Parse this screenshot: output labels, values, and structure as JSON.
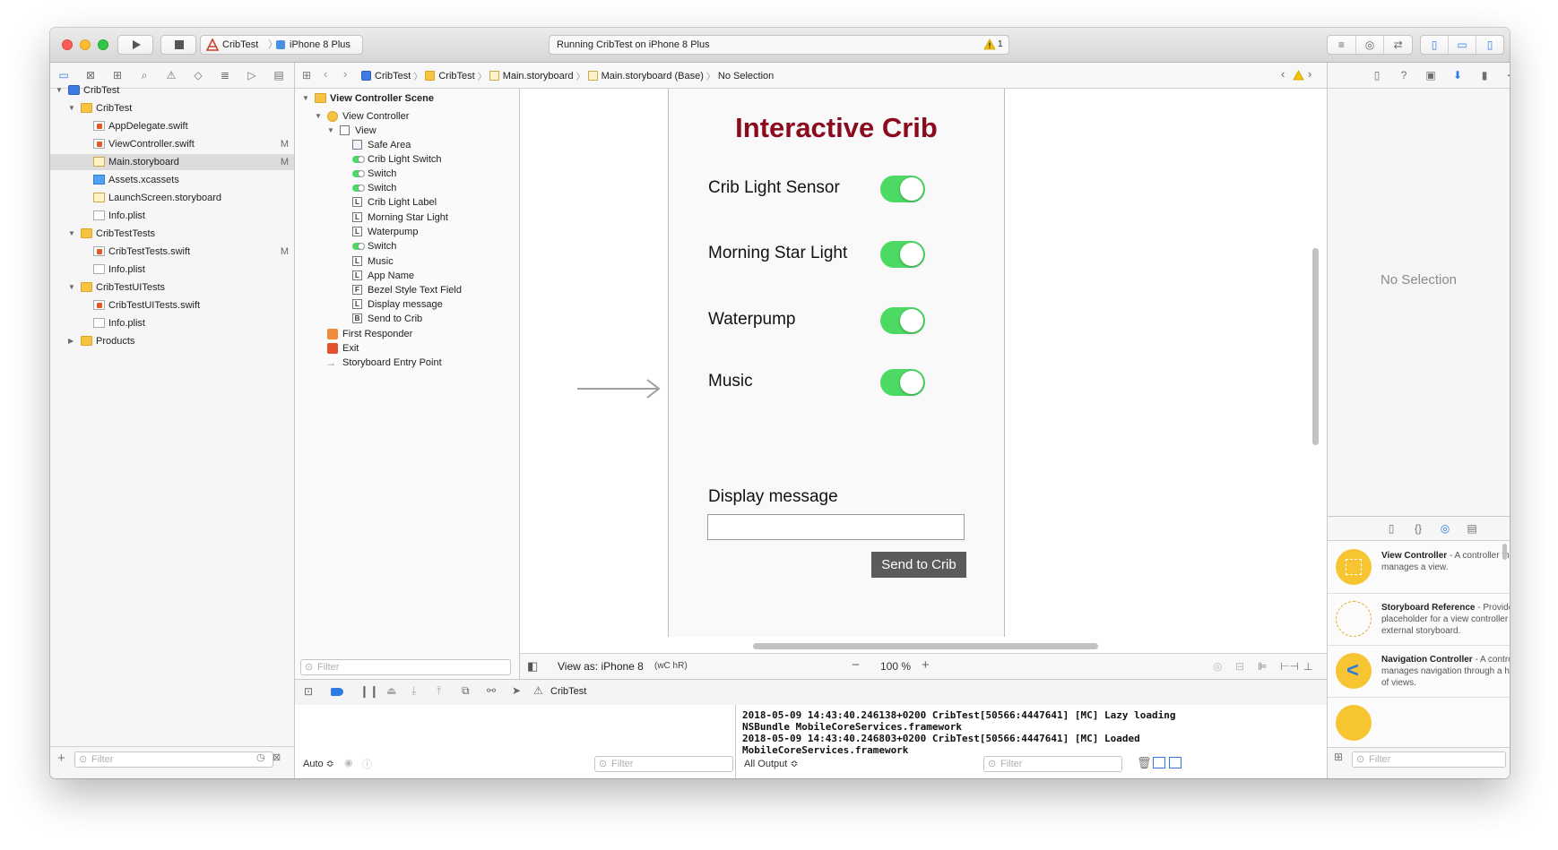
{
  "toolbar": {
    "scheme_project": "CribTest",
    "scheme_device": "iPhone 8 Plus",
    "status_text": "Running CribTest on iPhone 8 Plus",
    "warning_count": "1"
  },
  "jumpbar": {
    "items": [
      "CribTest",
      "CribTest",
      "Main.storyboard",
      "Main.storyboard (Base)",
      "No Selection"
    ]
  },
  "navigator": {
    "rows": [
      {
        "label": "CribTest",
        "mark": ""
      },
      {
        "label": "CribTest",
        "mark": ""
      },
      {
        "label": "AppDelegate.swift",
        "mark": ""
      },
      {
        "label": "ViewController.swift",
        "mark": "M"
      },
      {
        "label": "Main.storyboard",
        "mark": "M"
      },
      {
        "label": "Assets.xcassets",
        "mark": ""
      },
      {
        "label": "LaunchScreen.storyboard",
        "mark": ""
      },
      {
        "label": "Info.plist",
        "mark": ""
      },
      {
        "label": "CribTestTests",
        "mark": ""
      },
      {
        "label": "CribTestTests.swift",
        "mark": "M"
      },
      {
        "label": "Info.plist",
        "mark": ""
      },
      {
        "label": "CribTestUITests",
        "mark": ""
      },
      {
        "label": "CribTestUITests.swift",
        "mark": ""
      },
      {
        "label": "Info.plist",
        "mark": ""
      },
      {
        "label": "Products",
        "mark": ""
      }
    ],
    "filter_placeholder": "Filter"
  },
  "outline": {
    "rows": [
      {
        "label": "View Controller Scene"
      },
      {
        "label": "View Controller"
      },
      {
        "label": "View"
      },
      {
        "label": "Safe Area"
      },
      {
        "label": "Crib Light Switch"
      },
      {
        "label": "Switch"
      },
      {
        "label": "Switch"
      },
      {
        "label": "Crib Light Label"
      },
      {
        "label": "Morning Star Light"
      },
      {
        "label": "Waterpump"
      },
      {
        "label": "Switch"
      },
      {
        "label": "Music"
      },
      {
        "label": "App Name"
      },
      {
        "label": "Bezel Style Text Field"
      },
      {
        "label": "Display message"
      },
      {
        "label": "Send to Crib"
      },
      {
        "label": "First Responder"
      },
      {
        "label": "Exit"
      },
      {
        "label": "Storyboard Entry Point"
      }
    ],
    "filter_placeholder": "Filter"
  },
  "canvas": {
    "app_title": "Interactive Crib",
    "app_title_color": "#8b0a1e",
    "rows": [
      {
        "label": "Crib Light Sensor",
        "on": true
      },
      {
        "label": "Morning Star Light",
        "on": true
      },
      {
        "label": "Waterpump",
        "on": true
      },
      {
        "label": "Music",
        "on": true
      }
    ],
    "display_label": "Display message",
    "send_button": "Send to Crib",
    "view_as": "View as: iPhone 8",
    "size_class": "(wC hR)",
    "zoom": "100 %"
  },
  "debug": {
    "process": "CribTest",
    "variables_mode": "Auto ≎",
    "output_mode": "All Output ≎",
    "console_lines": [
      "2018-05-09 14:43:40.246138+0200 CribTest[50566:4447641] [MC] Lazy loading",
      "NSBundle MobileCoreServices.framework",
      "2018-05-09 14:43:40.246803+0200 CribTest[50566:4447641] [MC] Loaded",
      "MobileCoreServices.framework"
    ],
    "filter_placeholder": "Filter"
  },
  "inspector": {
    "empty_text": "No Selection"
  },
  "library": {
    "items": [
      {
        "title": "View Controller",
        "desc": " - A controller that manages a view."
      },
      {
        "title": "Storyboard Reference",
        "desc": " - Provides a placeholder for a view controller in an external storyboard."
      },
      {
        "title": "Navigation Controller",
        "desc": " - A controller that manages navigation through a hierarchy of views."
      }
    ],
    "filter_placeholder": "Filter"
  },
  "colors": {
    "accent_blue": "#2f7be5",
    "switch_green": "#4cd964",
    "warning_yellow": "#f5c400"
  }
}
